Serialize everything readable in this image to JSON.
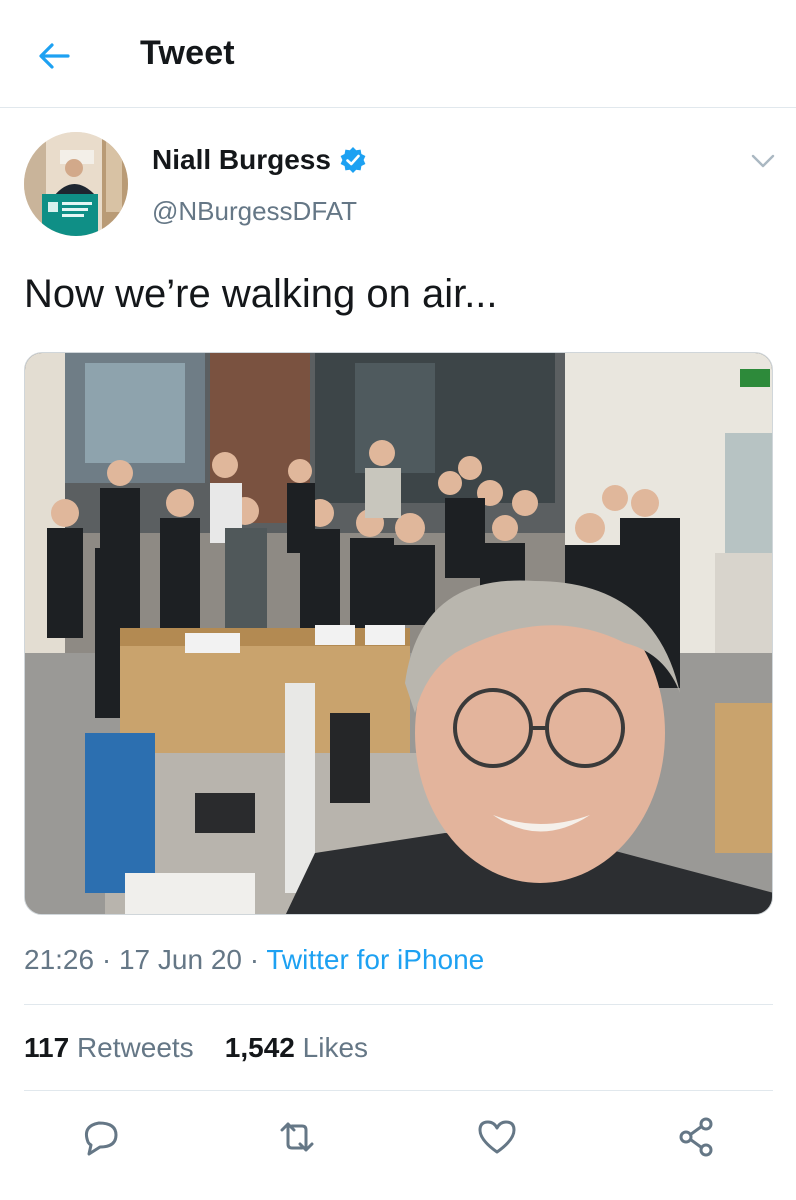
{
  "header": {
    "title": "Tweet"
  },
  "author": {
    "name": "Niall Burgess",
    "handle": "@NBurgessDFAT",
    "verified": true
  },
  "tweet": {
    "text": "Now we’re walking on air...",
    "time": "21:26",
    "date": "17 Jun 20",
    "source": "Twitter for iPhone",
    "separator": "·"
  },
  "stats": {
    "retweets_count": "117",
    "retweets_label": "Retweets",
    "likes_count": "1,542",
    "likes_label": "Likes"
  },
  "actions": [
    "reply-icon",
    "retweet-icon",
    "like-icon",
    "share-icon"
  ],
  "colors": {
    "accent": "#1da1f2",
    "secondary_text": "#657786",
    "divider": "#e1e8ed"
  }
}
